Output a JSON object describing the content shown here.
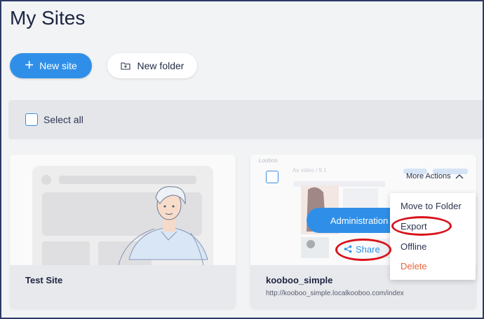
{
  "page": {
    "title": "My Sites"
  },
  "toolbar": {
    "new_site_label": "New site",
    "new_folder_label": "New folder"
  },
  "selection": {
    "select_all_label": "Select all"
  },
  "sites": [
    {
      "name": "Test Site",
      "url": ""
    },
    {
      "name": "kooboo_simple",
      "url": "http://kooboo_simple.localkooboo.com/index",
      "thumb_brand": "Looboo",
      "thumb_heading": "As video / 9.1",
      "more_actions_label": "More Actions",
      "administration_label": "Administration",
      "share_label": "Share"
    }
  ],
  "more_actions_menu": [
    {
      "label": "Move to Folder"
    },
    {
      "label": "Export"
    },
    {
      "label": "Offline"
    },
    {
      "label": "Delete"
    }
  ],
  "colors": {
    "primary": "#2f8fe8",
    "danger": "#e8643c",
    "annotation": "#d8131c"
  }
}
